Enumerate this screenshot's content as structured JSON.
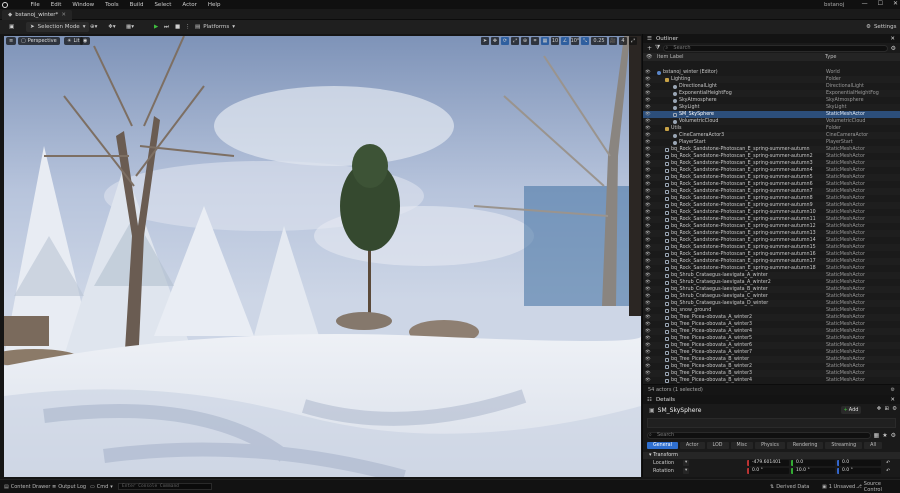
{
  "app": {
    "menu": [
      "File",
      "Edit",
      "Window",
      "Tools",
      "Build",
      "Select",
      "Actor",
      "Help"
    ],
    "project_title": "bstanoj",
    "window_controls": [
      "—",
      "☐",
      "✕"
    ]
  },
  "tab": {
    "label": "bstanoj_winter*"
  },
  "toolbar": {
    "mode_label": "Selection Mode",
    "platforms_label": "Platforms",
    "settings_label": "Settings"
  },
  "viewport": {
    "perspective_label": "Perspective",
    "lit_label": "Lit",
    "snap_value": "0.25",
    "camera_speed": "4"
  },
  "outliner": {
    "title": "Outliner",
    "search_placeholder": "Search",
    "col_label": "Item Label",
    "col_type": "Type",
    "footer": "54 actors (1 selected)",
    "rows": [
      {
        "label": "bstanoj_winter (Editor)",
        "type": "World",
        "indent": 0,
        "icon": "world"
      },
      {
        "label": "Lighting",
        "type": "Folder",
        "indent": 1,
        "icon": "folder"
      },
      {
        "label": "DirectionalLight",
        "type": "DirectionalLight",
        "indent": 2,
        "icon": "actor"
      },
      {
        "label": "ExponentialHeightFog",
        "type": "ExponentialHeightFog",
        "indent": 2,
        "icon": "actor"
      },
      {
        "label": "SkyAtmosphere",
        "type": "SkyAtmosphere",
        "indent": 2,
        "icon": "actor"
      },
      {
        "label": "SkyLight",
        "type": "SkyLight",
        "indent": 2,
        "icon": "actor"
      },
      {
        "label": "SM_SkySphere",
        "type": "StaticMeshActor",
        "indent": 2,
        "icon": "sm",
        "selected": true
      },
      {
        "label": "VolumetricCloud",
        "type": "VolumetricCloud",
        "indent": 2,
        "icon": "actor"
      },
      {
        "label": "Utils",
        "type": "Folder",
        "indent": 1,
        "icon": "folder"
      },
      {
        "label": "CineCameraActor3",
        "type": "CineCameraActor",
        "indent": 2,
        "icon": "actor"
      },
      {
        "label": "PlayerStart",
        "type": "PlayerStart",
        "indent": 2,
        "icon": "actor"
      },
      {
        "label": "bq_Rock_Sandstone-Photoscan_E_spring-summer-autumn",
        "type": "StaticMeshActor",
        "indent": 1,
        "icon": "sm"
      },
      {
        "label": "bq_Rock_Sandstone-Photoscan_E_spring-summer-autumn2",
        "type": "StaticMeshActor",
        "indent": 1,
        "icon": "sm"
      },
      {
        "label": "bq_Rock_Sandstone-Photoscan_E_spring-summer-autumn3",
        "type": "StaticMeshActor",
        "indent": 1,
        "icon": "sm"
      },
      {
        "label": "bq_Rock_Sandstone-Photoscan_E_spring-summer-autumn4",
        "type": "StaticMeshActor",
        "indent": 1,
        "icon": "sm"
      },
      {
        "label": "bq_Rock_Sandstone-Photoscan_E_spring-summer-autumn5",
        "type": "StaticMeshActor",
        "indent": 1,
        "icon": "sm"
      },
      {
        "label": "bq_Rock_Sandstone-Photoscan_E_spring-summer-autumn6",
        "type": "StaticMeshActor",
        "indent": 1,
        "icon": "sm"
      },
      {
        "label": "bq_Rock_Sandstone-Photoscan_E_spring-summer-autumn7",
        "type": "StaticMeshActor",
        "indent": 1,
        "icon": "sm"
      },
      {
        "label": "bq_Rock_Sandstone-Photoscan_E_spring-summer-autumn8",
        "type": "StaticMeshActor",
        "indent": 1,
        "icon": "sm"
      },
      {
        "label": "bq_Rock_Sandstone-Photoscan_E_spring-summer-autumn9",
        "type": "StaticMeshActor",
        "indent": 1,
        "icon": "sm"
      },
      {
        "label": "bq_Rock_Sandstone-Photoscan_E_spring-summer-autumn10",
        "type": "StaticMeshActor",
        "indent": 1,
        "icon": "sm"
      },
      {
        "label": "bq_Rock_Sandstone-Photoscan_E_spring-summer-autumn11",
        "type": "StaticMeshActor",
        "indent": 1,
        "icon": "sm"
      },
      {
        "label": "bq_Rock_Sandstone-Photoscan_E_spring-summer-autumn12",
        "type": "StaticMeshActor",
        "indent": 1,
        "icon": "sm"
      },
      {
        "label": "bq_Rock_Sandstone-Photoscan_E_spring-summer-autumn13",
        "type": "StaticMeshActor",
        "indent": 1,
        "icon": "sm"
      },
      {
        "label": "bq_Rock_Sandstone-Photoscan_E_spring-summer-autumn14",
        "type": "StaticMeshActor",
        "indent": 1,
        "icon": "sm"
      },
      {
        "label": "bq_Rock_Sandstone-Photoscan_E_spring-summer-autumn15",
        "type": "StaticMeshActor",
        "indent": 1,
        "icon": "sm"
      },
      {
        "label": "bq_Rock_Sandstone-Photoscan_E_spring-summer-autumn16",
        "type": "StaticMeshActor",
        "indent": 1,
        "icon": "sm"
      },
      {
        "label": "bq_Rock_Sandstone-Photoscan_E_spring-summer-autumn17",
        "type": "StaticMeshActor",
        "indent": 1,
        "icon": "sm"
      },
      {
        "label": "bq_Rock_Sandstone-Photoscan_E_spring-summer-autumn18",
        "type": "StaticMeshActor",
        "indent": 1,
        "icon": "sm"
      },
      {
        "label": "bq_Shrub_Crataegus-laevigata_A_winter",
        "type": "StaticMeshActor",
        "indent": 1,
        "icon": "sm"
      },
      {
        "label": "bq_Shrub_Crataegus-laevigata_A_winter2",
        "type": "StaticMeshActor",
        "indent": 1,
        "icon": "sm"
      },
      {
        "label": "bq_Shrub_Crataegus-laevigata_B_winter",
        "type": "StaticMeshActor",
        "indent": 1,
        "icon": "sm"
      },
      {
        "label": "bq_Shrub_Crataegus-laevigata_C_winter",
        "type": "StaticMeshActor",
        "indent": 1,
        "icon": "sm"
      },
      {
        "label": "bq_Shrub_Crataegus-laevigata_D_winter",
        "type": "StaticMeshActor",
        "indent": 1,
        "icon": "sm"
      },
      {
        "label": "bq_snow_ground",
        "type": "StaticMeshActor",
        "indent": 1,
        "icon": "sm"
      },
      {
        "label": "bq_Tree_Picea-obovata_A_winter2",
        "type": "StaticMeshActor",
        "indent": 1,
        "icon": "sm"
      },
      {
        "label": "bq_Tree_Picea-obovata_A_winter3",
        "type": "StaticMeshActor",
        "indent": 1,
        "icon": "sm"
      },
      {
        "label": "bq_Tree_Picea-obovata_A_winter4",
        "type": "StaticMeshActor",
        "indent": 1,
        "icon": "sm"
      },
      {
        "label": "bq_Tree_Picea-obovata_A_winter5",
        "type": "StaticMeshActor",
        "indent": 1,
        "icon": "sm"
      },
      {
        "label": "bq_Tree_Picea-obovata_A_winter6",
        "type": "StaticMeshActor",
        "indent": 1,
        "icon": "sm"
      },
      {
        "label": "bq_Tree_Picea-obovata_A_winter7",
        "type": "StaticMeshActor",
        "indent": 1,
        "icon": "sm"
      },
      {
        "label": "bq_Tree_Picea-obovata_B_winter",
        "type": "StaticMeshActor",
        "indent": 1,
        "icon": "sm"
      },
      {
        "label": "bq_Tree_Picea-obovata_B_winter2",
        "type": "StaticMeshActor",
        "indent": 1,
        "icon": "sm"
      },
      {
        "label": "bq_Tree_Picea-obovata_B_winter3",
        "type": "StaticMeshActor",
        "indent": 1,
        "icon": "sm"
      },
      {
        "label": "bq_Tree_Picea-obovata_B_winter4",
        "type": "StaticMeshActor",
        "indent": 1,
        "icon": "sm"
      },
      {
        "label": "bq_Tree_Picea-obovata_B_winter5",
        "type": "StaticMeshActor",
        "indent": 1,
        "icon": "sm"
      }
    ]
  },
  "details": {
    "title": "Details",
    "selected_name": "SM_SkySphere",
    "add_label": "Add",
    "search_placeholder": "Search",
    "tabs": [
      "General",
      "Actor",
      "LOD",
      "Misc",
      "Physics",
      "Rendering",
      "Streaming",
      "All"
    ],
    "section": "Transform",
    "location_label": "Location",
    "location": [
      "-479.601401",
      "0.0",
      "0.0"
    ],
    "rotation_label": "Rotation",
    "rotation": [
      "0.0 °",
      "10.0 °",
      "0.0 °"
    ]
  },
  "statusbar": {
    "content_drawer": "Content Drawer",
    "output_log": "Output Log",
    "cmd": "Cmd",
    "cmd_placeholder": "Enter Console Command",
    "derived_data": "Derived Data",
    "unsaved": "1 Unsaved",
    "source_control": "Source Control"
  },
  "colors": {
    "selection": "#2c4e7a",
    "accent": "#2f6fcf",
    "play": "#3fbf3f"
  }
}
